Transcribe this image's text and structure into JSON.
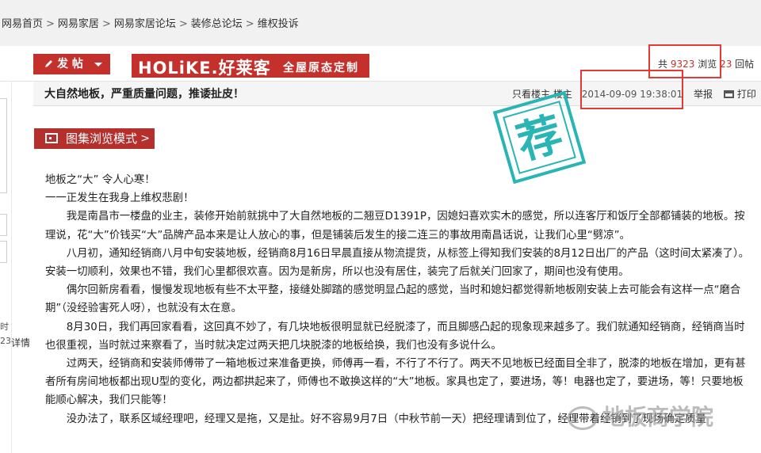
{
  "breadcrumb": [
    "网易首页",
    "网易家居",
    "网易家居论坛",
    "装修总论坛",
    "维权投诉"
  ],
  "post_button": "发 帖",
  "banner": {
    "logo": "HOLiKE.好莱客",
    "slogan": "全屋原态定制"
  },
  "stats": {
    "total_label": "共",
    "views": "9323",
    "views_label": "浏览",
    "replies": "23",
    "replies_label": "回帖"
  },
  "post": {
    "title": "大自然地板，严重质量问题，推诿扯皮！",
    "only_op": "只看楼主",
    "floor": "楼主",
    "date": "2014-09-09 19:38:01",
    "report": "举报",
    "print": "打印"
  },
  "left_sidebar": {
    "frag1": "时",
    "frag2": "23",
    "detail": "详情"
  },
  "gallery_button": "图集浏览模式",
  "stamp": "荐",
  "content": [
    "地板之“大” 令人心寒！",
    "一一正发生在我身上维权悲剧！",
    "　　我是南昌市一楼盘的业主，装修开始前就挑中了大自然地板的二翘豆D1391P，因媳妇喜欢实木的感觉，所以连客厅和饭厅全部都铺装的地板。按理说，花“大”价钱买“大”品牌产品本来是让人放心的事，但是铺装后发生的接二连三的事故用南昌话说，让我们心里“劈凉”。",
    "　　八月初，通知经销商八月中旬安装地板，经销商8月16日早晨直接从物流提货，从标签上得知我们安装的8月12日出厂的产品（这时间太紧凑了）。安装一切顺利，效果也不错，我们心里都很欢喜。因为是新房，所以也没有居住，装完了后就关门回家了，期间也没有使用。",
    "　　偶尔回新房看看，慢慢发现地板有些不太平整，接缝处脚踏的感觉明显凸起的感觉，当时和媳妇都觉得新地板刚安装上去可能会有这样一点“磨合期”（没经验害死人呀），也就没有太在意。",
    "　　8月30日，我们再回家看看，这回真不妙了，有几块地板很明显就已经脱漆了，而且脚感凸起的现象现来越多了。我们就通知经销商，经销商当时也很重视，当时就过来察看了，当时就决定过两天把几块脱漆的地板给换，我们也没有多说什么。",
    "　　过两天，经销商和安装师傅带了一箱地板过来准备更换，师傅再一看，不行了不行了。两天不见地板已经面目全非了，脱漆的地板在增加，更有甚者所有房间地板都出现U型的变化，两边都拱起来了，师傅也不敢换这样的“大”地板。家具也定了，要进场，等！电器也定了，要进场，等！只要地板能顺心解决，我们只能等！",
    "　　没办法了，联系区域经理吧，经理又是拖，又是扯。好不容易9月7日（中秋节前一天）把经理请到位了，经理带着经销到了现场确定质量"
  ],
  "watermark": "地板商学院",
  "colors": {
    "brand_red": "#c4312c",
    "highlight_box": "#e53935",
    "stamp": "#2ab5b5"
  }
}
